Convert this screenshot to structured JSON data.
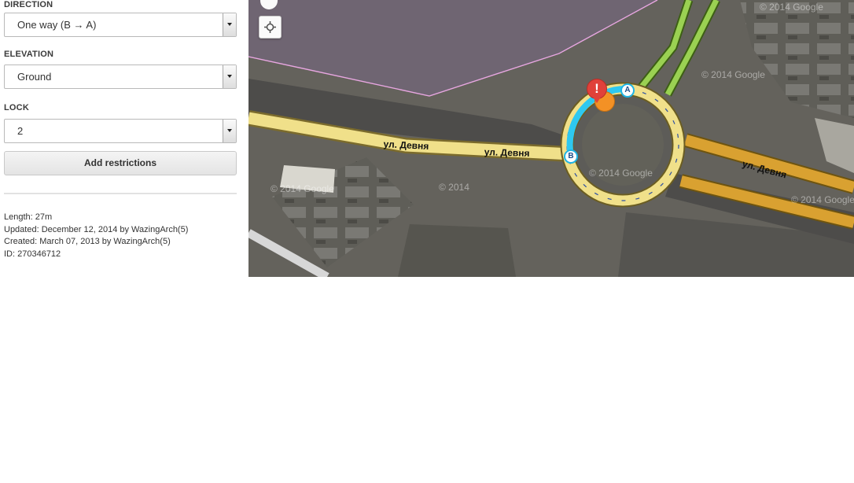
{
  "panel": {
    "direction": {
      "label": "DIRECTION",
      "value": "One way (B → A)"
    },
    "elevation": {
      "label": "ELEVATION",
      "value": "Ground"
    },
    "lock": {
      "label": "LOCK",
      "value": "2"
    },
    "add_restrictions_label": "Add restrictions",
    "meta": {
      "length": "Length: 27m",
      "updated": "Updated: December 12, 2014 by WazingArch(5)",
      "created": "Created: March 07, 2013 by WazingArch(5)",
      "id": "ID: 270346712"
    }
  },
  "map": {
    "road_labels": [
      "ул. Девня",
      "ул. Девня",
      "ул. Девня"
    ],
    "node_a": "A",
    "node_b": "B",
    "alert_symbol": "!",
    "watermarks": [
      "© 2014 Google",
      "© 2014 Google",
      "© 2014 Google",
      "© 2014",
      "© 2014 Google",
      "© 2014 Google"
    ],
    "colors": {
      "primary_road": "#f0e08a",
      "street": "#d9a131",
      "ramp": "#9ad152",
      "selected_segment": "#2ec8f0",
      "city_boundary": "#e7a6e0",
      "alert": "#e0413a"
    },
    "icons": [
      "locate-icon",
      "alert-pin-icon",
      "node-a-marker",
      "node-b-marker"
    ]
  }
}
